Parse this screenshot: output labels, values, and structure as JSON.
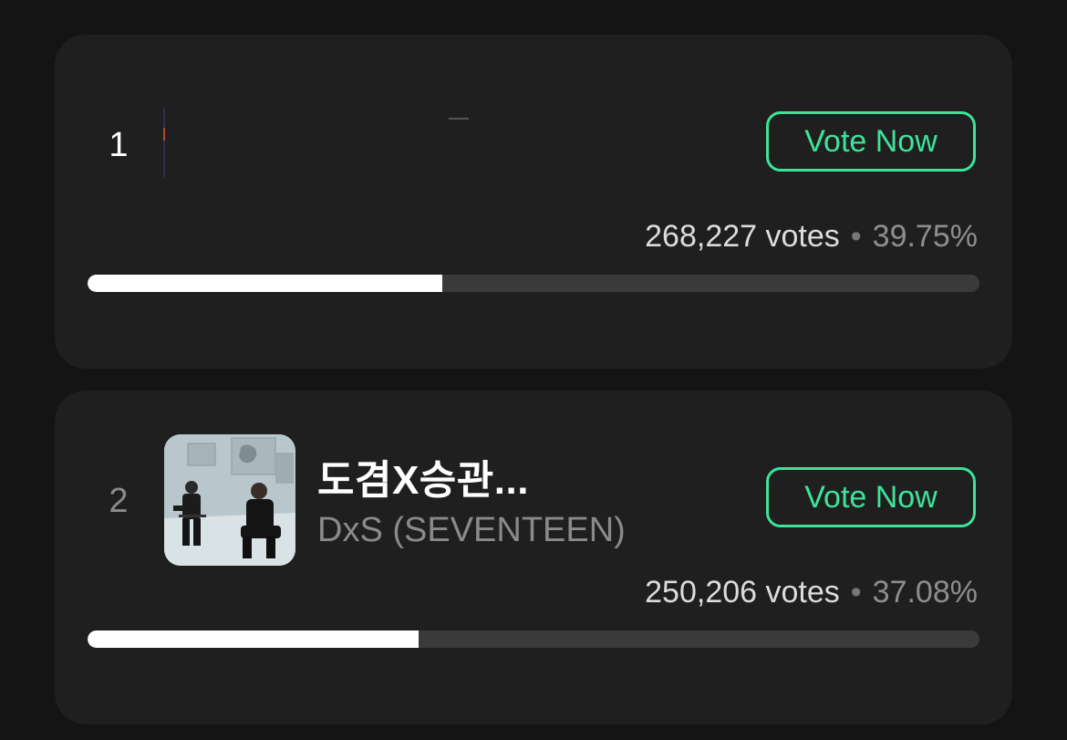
{
  "entries": [
    {
      "rank": "1",
      "title": "",
      "artist": "",
      "vote_label": "Vote Now",
      "votes_text": "268,227 votes",
      "separator": "•",
      "percent_text": "39.75%",
      "percent": 39.75
    },
    {
      "rank": "2",
      "title": "도겸X승관...",
      "artist": "DxS (SEVENTEEN)",
      "vote_label": "Vote Now",
      "votes_text": "250,206 votes",
      "separator": "•",
      "percent_text": "37.08%",
      "percent": 37.08
    }
  ],
  "colors": {
    "accent": "#3de39a",
    "card_bg": "#1f1f1f",
    "page_bg": "#141414",
    "bar_track": "#3a3a3a",
    "bar_fill": "#ffffff"
  }
}
